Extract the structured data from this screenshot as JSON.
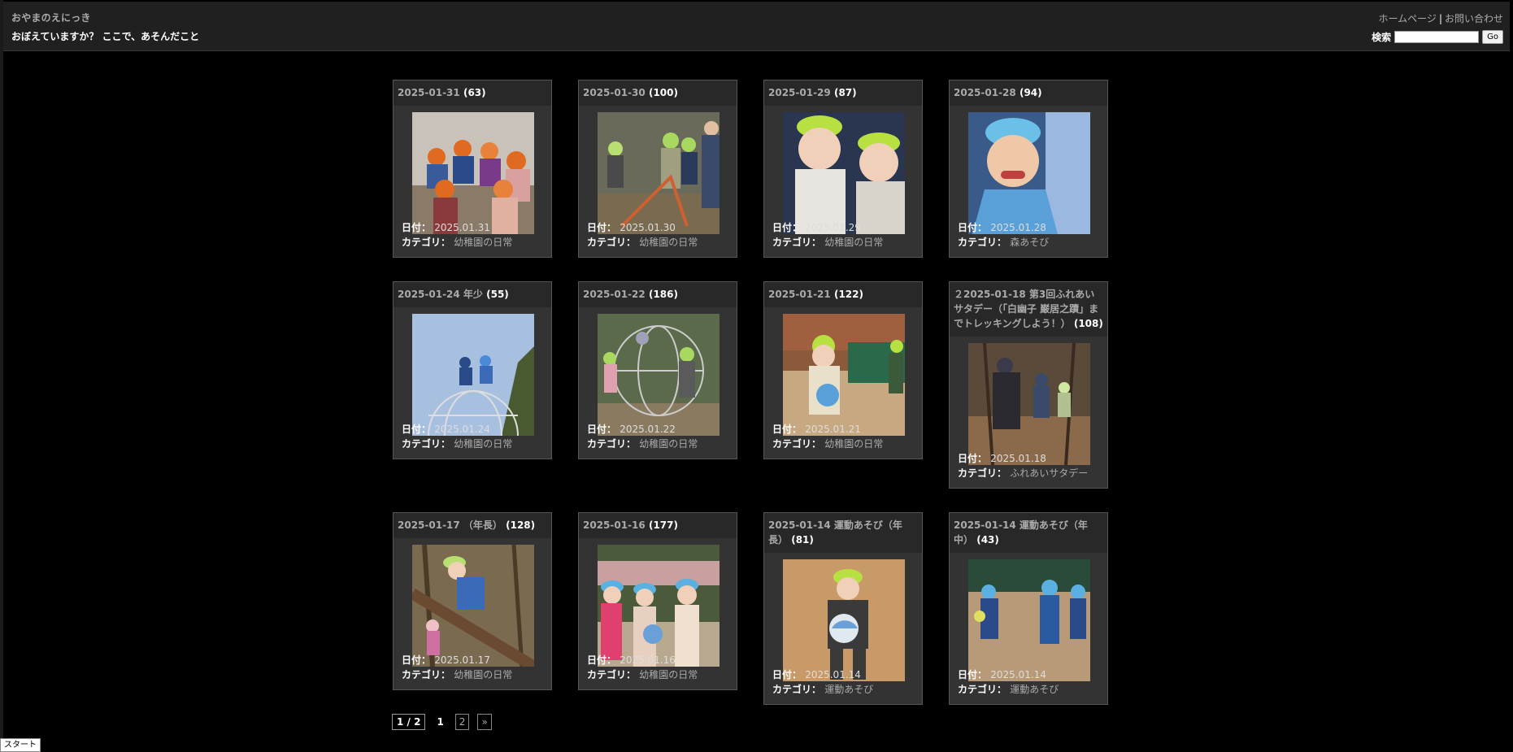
{
  "header": {
    "site_title": "おやまのえにっき",
    "subtitle": "おぼえていますか？ ここで、あそんだこと",
    "home_link": "ホームページ",
    "separator": "|",
    "contact_link": "お問い合わせ",
    "search_label": "検索",
    "search_value": "",
    "go_label": "Go"
  },
  "labels": {
    "date": "日付：",
    "category": "カテゴリ："
  },
  "albums": [
    {
      "title": "2025-01-31",
      "count": "(63)",
      "date": "2025.01.31",
      "category": "幼稚園の日常"
    },
    {
      "title": "2025-01-30",
      "count": "(100)",
      "date": "2025.01.30",
      "category": "幼稚園の日常"
    },
    {
      "title": "2025-01-29",
      "count": "(87)",
      "date": "2025.01.29",
      "category": "幼稚園の日常"
    },
    {
      "title": "2025-01-28",
      "count": "(94)",
      "date": "2025.01.28",
      "category": "森あそび"
    },
    {
      "title": "2025-01-24 年少",
      "count": "(55)",
      "date": "2025.01.24",
      "category": "幼稚園の日常"
    },
    {
      "title": "2025-01-22",
      "count": "(186)",
      "date": "2025.01.22",
      "category": "幼稚園の日常"
    },
    {
      "title": "2025-01-21",
      "count": "(122)",
      "date": "2025.01.21",
      "category": "幼稚園の日常"
    },
    {
      "title": "２2025-01-18 第3回ふれあいサタデー（「白幽子 巌居之蹟」までトレッキングしよう！）",
      "count": "(108)",
      "date": "2025.01.18",
      "category": "ふれあいサタデー"
    },
    {
      "title": "2025-01-17 （年長）",
      "count": "(128)",
      "date": "2025.01.17",
      "category": "幼稚園の日常"
    },
    {
      "title": "2025-01-16",
      "count": "(177)",
      "date": "2025.01.16",
      "category": "幼稚園の日常"
    },
    {
      "title": "2025-01-14 運動あそび（年長）",
      "count": "(81)",
      "date": "2025.01.14",
      "category": "運動あそび"
    },
    {
      "title": "2025-01-14 運動あそび（年中）",
      "count": "(43)",
      "date": "2025.01.14",
      "category": "運動あそび"
    }
  ],
  "pager": {
    "indicator": "1 / 2",
    "current": "1",
    "next_page": "2",
    "next_arrow": "»"
  },
  "taskbar": {
    "start": "スタート"
  }
}
